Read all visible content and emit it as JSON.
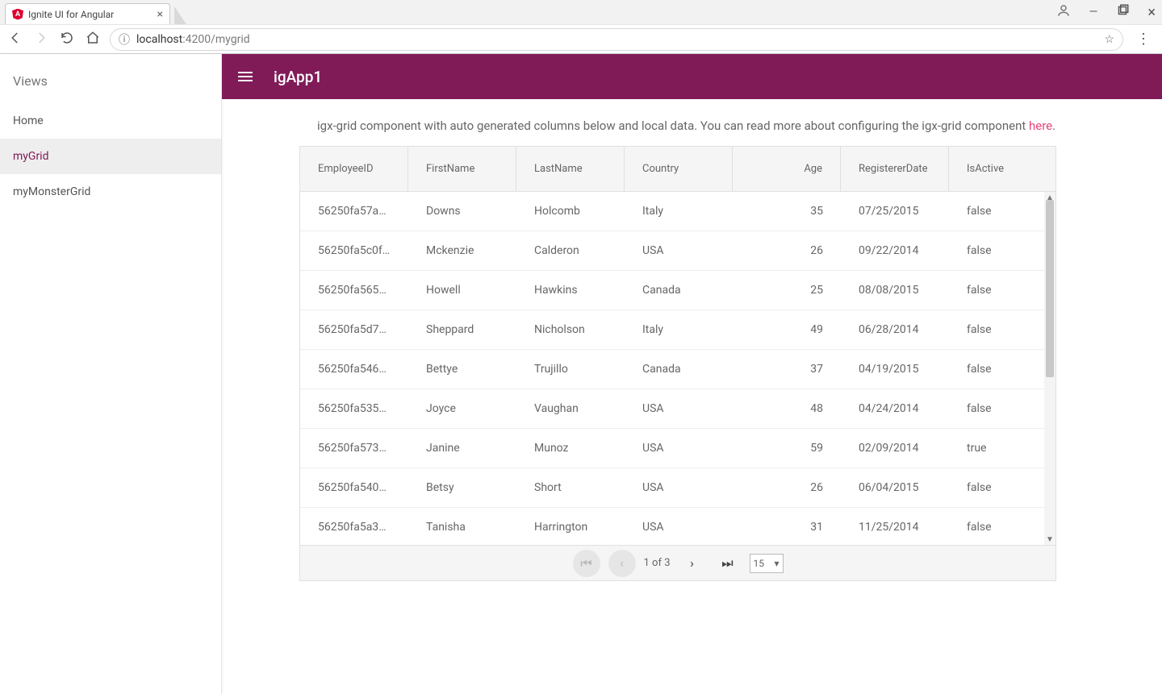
{
  "browser": {
    "tab_title": "Ignite UI for Angular",
    "favicon_letter": "A",
    "url_host": "localhost",
    "url_port": ":4200",
    "url_path": "/mygrid"
  },
  "sidebar": {
    "heading": "Views",
    "items": [
      {
        "label": "Home",
        "active": false
      },
      {
        "label": "myGrid",
        "active": true
      },
      {
        "label": "myMonsterGrid",
        "active": false
      }
    ]
  },
  "topbar": {
    "title": "igApp1"
  },
  "intro": {
    "text": "igx-grid component with auto generated columns below and local data. You can read more about configuring the igx-grid component ",
    "link_text": "here",
    "suffix": "."
  },
  "grid": {
    "columns": [
      "EmployeeID",
      "FirstName",
      "LastName",
      "Country",
      "Age",
      "RegistererDate",
      "IsActive"
    ],
    "rows": [
      {
        "id": "56250fa57ab...",
        "first": "Downs",
        "last": "Holcomb",
        "country": "Italy",
        "age": "35",
        "date": "07/25/2015",
        "active": "false"
      },
      {
        "id": "56250fa5c0fd...",
        "first": "Mckenzie",
        "last": "Calderon",
        "country": "USA",
        "age": "26",
        "date": "09/22/2014",
        "active": "false"
      },
      {
        "id": "56250fa565a...",
        "first": "Howell",
        "last": "Hawkins",
        "country": "Canada",
        "age": "25",
        "date": "08/08/2015",
        "active": "false"
      },
      {
        "id": "56250fa5d71...",
        "first": "Sheppard",
        "last": "Nicholson",
        "country": "Italy",
        "age": "49",
        "date": "06/28/2014",
        "active": "false"
      },
      {
        "id": "56250fa546a...",
        "first": "Bettye",
        "last": "Trujillo",
        "country": "Canada",
        "age": "37",
        "date": "04/19/2015",
        "active": "false"
      },
      {
        "id": "56250fa5358...",
        "first": "Joyce",
        "last": "Vaughan",
        "country": "USA",
        "age": "48",
        "date": "04/24/2014",
        "active": "false"
      },
      {
        "id": "56250fa5732...",
        "first": "Janine",
        "last": "Munoz",
        "country": "USA",
        "age": "59",
        "date": "02/09/2014",
        "active": "true"
      },
      {
        "id": "56250fa540b...",
        "first": "Betsy",
        "last": "Short",
        "country": "USA",
        "age": "26",
        "date": "06/04/2015",
        "active": "false"
      },
      {
        "id": "56250fa5a33...",
        "first": "Tanisha",
        "last": "Harrington",
        "country": "USA",
        "age": "31",
        "date": "11/25/2014",
        "active": "false"
      }
    ],
    "paginator": {
      "page_text": "1 of 3",
      "page_size": "15"
    }
  }
}
